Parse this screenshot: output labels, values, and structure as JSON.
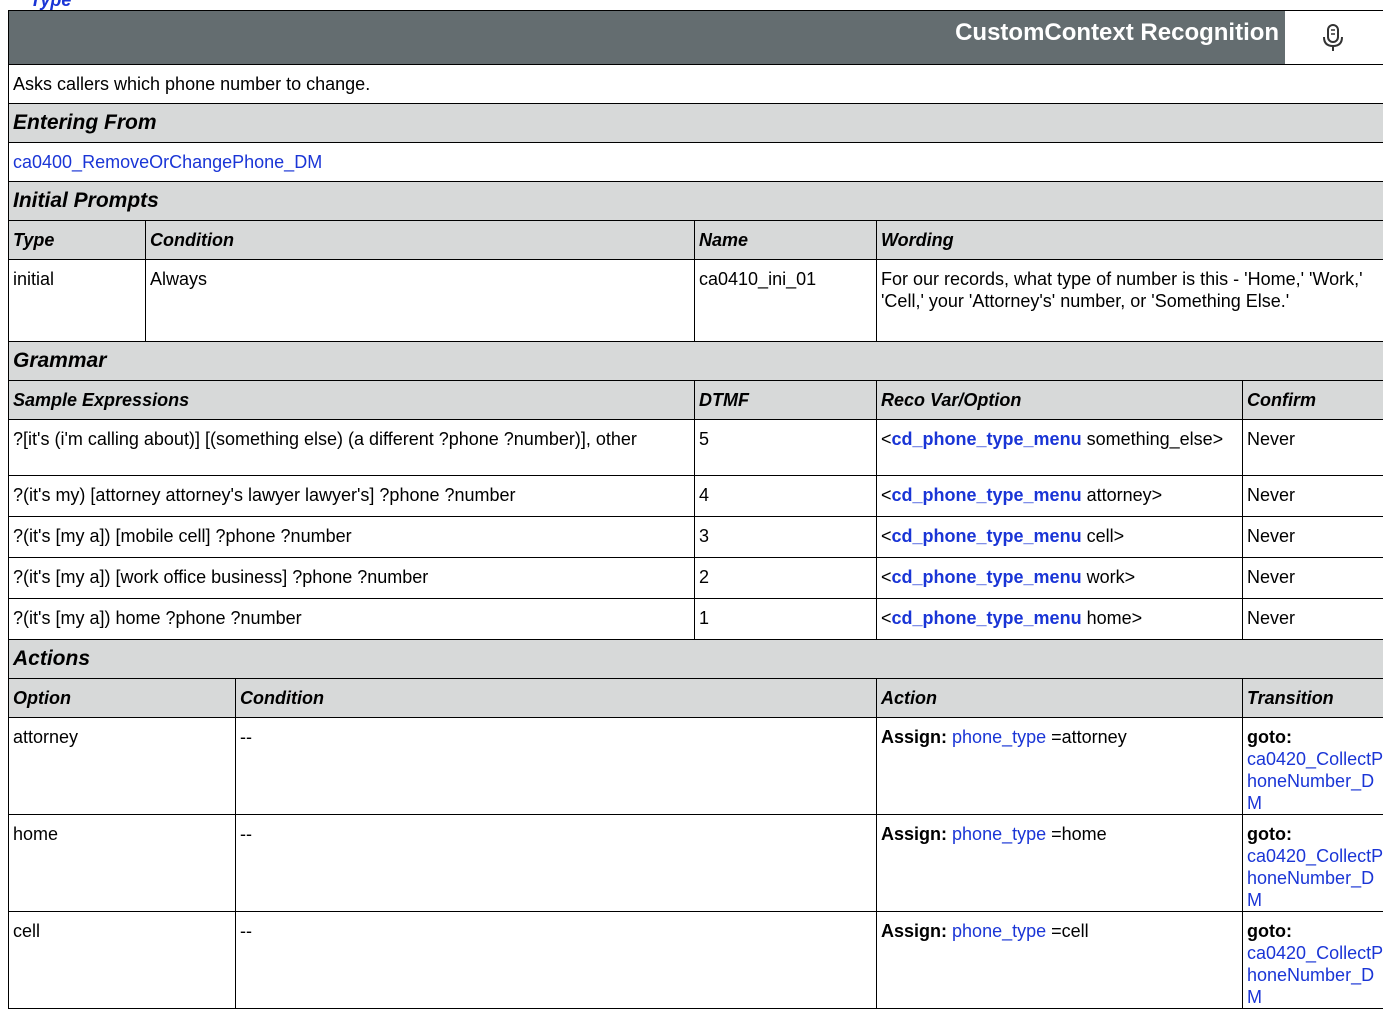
{
  "header": {
    "title": "CustomContext Recognition",
    "icon": "microphone-icon"
  },
  "description": "Asks callers which phone number to change.",
  "entering_from": {
    "label": "Entering From",
    "link": "ca0400_RemoveOrChangePhone_DM"
  },
  "initial_prompts": {
    "label": "Initial Prompts",
    "columns": [
      "Type",
      "Condition",
      "Name",
      "Wording"
    ],
    "rows": [
      {
        "type": "initial",
        "condition": "Always",
        "name": "ca0410_ini_01",
        "wording": "For our records, what type of number is this - 'Home,' 'Work,' 'Cell,' your 'Attorney's' number, or 'Something Else.'"
      }
    ]
  },
  "grammar": {
    "label": "Grammar",
    "columns": [
      "Sample Expressions",
      "DTMF",
      "Reco Var/Option",
      "Confirm"
    ],
    "reco_var": "cd_phone_type_menu",
    "rows": [
      {
        "expr": "?[it's (i'm calling about)] [(something else) (a different ?phone ?number)], other",
        "dtmf": "5",
        "option": "something_else>",
        "confirm": "Never"
      },
      {
        "expr": "?(it's my) [attorney attorney's lawyer lawyer's]  ?phone ?number",
        "dtmf": "4",
        "option": "attorney>",
        "confirm": "Never"
      },
      {
        "expr": "?(it's [my a]) [mobile cell] ?phone ?number",
        "dtmf": "3",
        "option": "cell>",
        "confirm": "Never"
      },
      {
        "expr": "?(it's [my a]) [work office business]  ?phone ?number",
        "dtmf": "2",
        "option": "work>",
        "confirm": "Never"
      },
      {
        "expr": "?(it's [my a]) home ?phone ?number",
        "dtmf": "1",
        "option": "home>",
        "confirm": "Never"
      }
    ]
  },
  "actions": {
    "label": "Actions",
    "columns": [
      "Option",
      "Condition",
      "Action",
      "Transition"
    ],
    "assign_label": "Assign:",
    "assign_var": "phone_type",
    "goto_label": "goto:",
    "rows": [
      {
        "option": "attorney",
        "condition": "--",
        "value": "=attorney",
        "target": "ca0420_CollectPhoneNumber_DM"
      },
      {
        "option": "home",
        "condition": "--",
        "value": "=home",
        "target": "ca0420_CollectPhoneNumber_DM"
      },
      {
        "option": "cell",
        "condition": "--",
        "value": "=cell",
        "target": "ca0420_CollectPhoneNumber_DM"
      }
    ]
  }
}
